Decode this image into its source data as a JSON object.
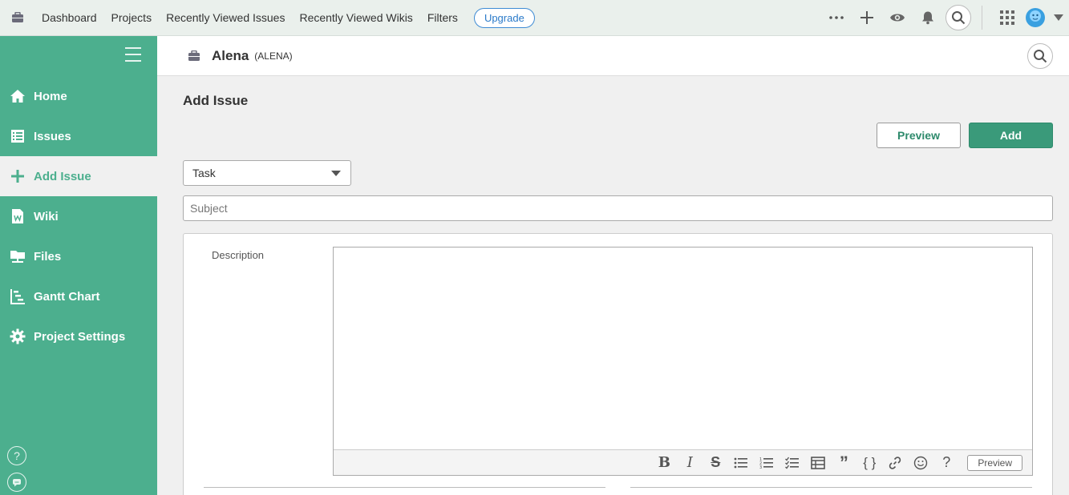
{
  "topnav": {
    "links": [
      "Dashboard",
      "Projects",
      "Recently Viewed Issues",
      "Recently Viewed Wikis",
      "Filters"
    ],
    "upgrade_label": "Upgrade",
    "icons": [
      "more-icon",
      "plus-icon",
      "eye-icon",
      "bell-icon",
      "search-icon",
      "apps-grid-icon",
      "avatar",
      "chevron-down-icon"
    ]
  },
  "sidebar": {
    "items": [
      {
        "label": "Home",
        "icon": "home-icon"
      },
      {
        "label": "Issues",
        "icon": "list-icon"
      },
      {
        "label": "Add Issue",
        "icon": "plus-icon",
        "active": true
      },
      {
        "label": "Wiki",
        "icon": "wiki-icon"
      },
      {
        "label": "Files",
        "icon": "files-icon"
      },
      {
        "label": "Gantt Chart",
        "icon": "gantt-icon"
      },
      {
        "label": "Project Settings",
        "icon": "gear-icon"
      }
    ],
    "bottom_icons": [
      "help-icon",
      "chat-icon"
    ]
  },
  "project": {
    "name": "Alena",
    "key": "(ALENA)"
  },
  "main": {
    "title": "Add Issue",
    "preview_label": "Preview",
    "add_label": "Add",
    "issue_type": "Task",
    "subject_placeholder": "Subject",
    "description_label": "Description",
    "editor_preview_label": "Preview"
  },
  "colors": {
    "sidebar_bg": "#4caf8e",
    "accent": "#3a9a7a",
    "upgrade": "#2a7ac9"
  }
}
